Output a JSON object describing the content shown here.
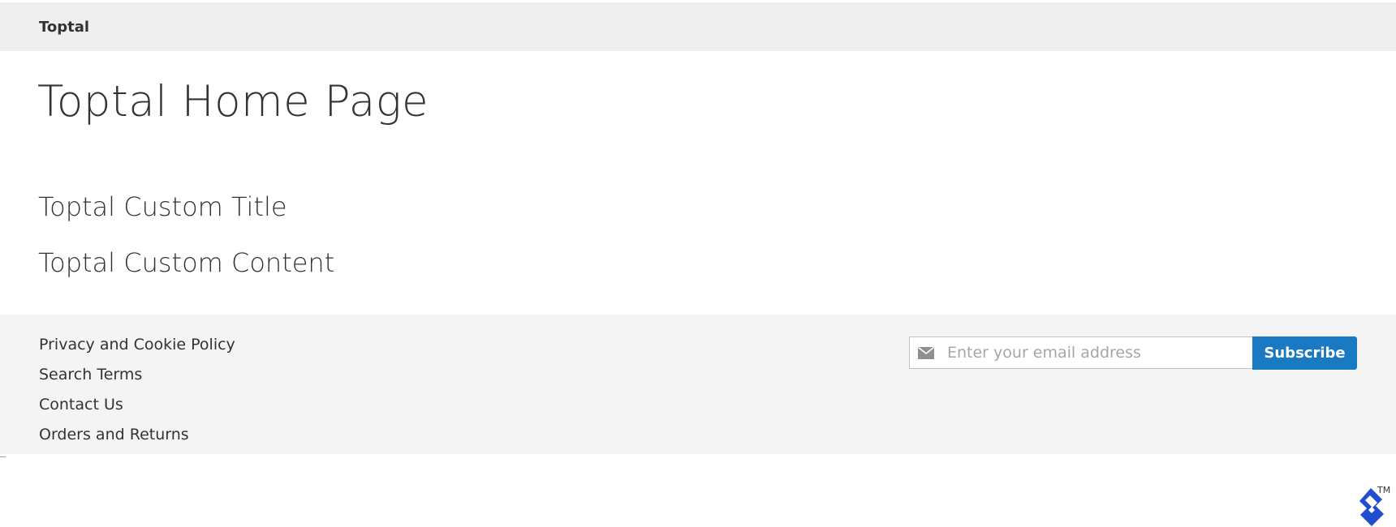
{
  "breadcrumb": {
    "store_name": "Toptal"
  },
  "main": {
    "page_title": "Toptal Home Page",
    "custom_title": "Toptal Custom Title",
    "custom_content": "Toptal Custom Content"
  },
  "footer": {
    "links": [
      {
        "label": "Privacy and Cookie Policy"
      },
      {
        "label": "Search Terms"
      },
      {
        "label": "Contact Us"
      },
      {
        "label": "Orders and Returns"
      }
    ],
    "newsletter": {
      "placeholder": "Enter your email address",
      "value": "",
      "subscribe_label": "Subscribe",
      "icon": "envelope-icon"
    }
  },
  "branding": {
    "logo_icon": "toptal-logo-icon",
    "trademark": "TM"
  },
  "colors": {
    "accent": "#1979c3",
    "logo": "#204ecf",
    "header_bg": "#f0eff0",
    "footer_bg": "#f4f4f4",
    "text": "#333333"
  }
}
